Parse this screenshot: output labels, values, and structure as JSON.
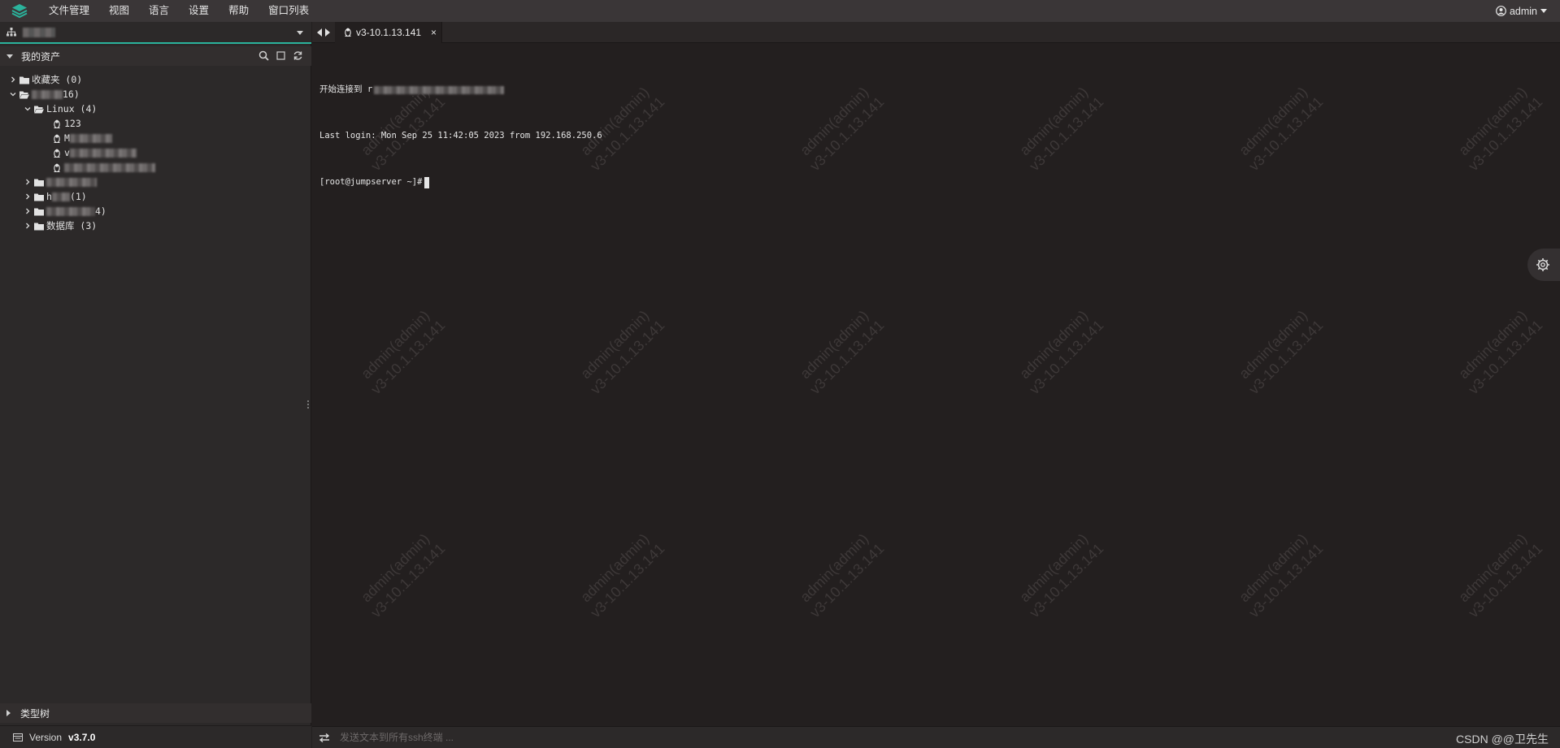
{
  "menubar": {
    "items": [
      "文件管理",
      "视图",
      "语言",
      "设置",
      "帮助",
      "窗口列表"
    ],
    "user": "admin"
  },
  "sidebar": {
    "assets_title": "我的资产",
    "tree": {
      "favorites": "收藏夹 (0)",
      "root_count": "16)",
      "linux": "Linux (4)",
      "host1": "123",
      "host2": "M",
      "host3": "v",
      "host4": "",
      "group_h": "h",
      "group_h_count": "(1)",
      "group3_count": "4)",
      "database": "数据库 (3)"
    },
    "category_tree": "类型树",
    "version_label": "Version",
    "version_value": "v3.7.0"
  },
  "tab": {
    "title": "v3-10.1.13.141",
    "close": "×"
  },
  "terminal": {
    "line1_prefix": "开始连接到 r",
    "line2": "Last login: Mon Sep 25 11:42:05 2023 from 192.168.250.6",
    "prompt": "[root@jumpserver ~]#"
  },
  "watermark": {
    "line1": "admin(admin)",
    "line2": "v3-10.1.13.141"
  },
  "bottom": {
    "placeholder": "发送文本到所有ssh终端 ...",
    "credit": "CSDN @@卫先生"
  },
  "colors": {
    "accent": "#2bb39c",
    "background": "#231f1f",
    "sidebar": "#2c2929",
    "menubar": "#3a3637"
  }
}
